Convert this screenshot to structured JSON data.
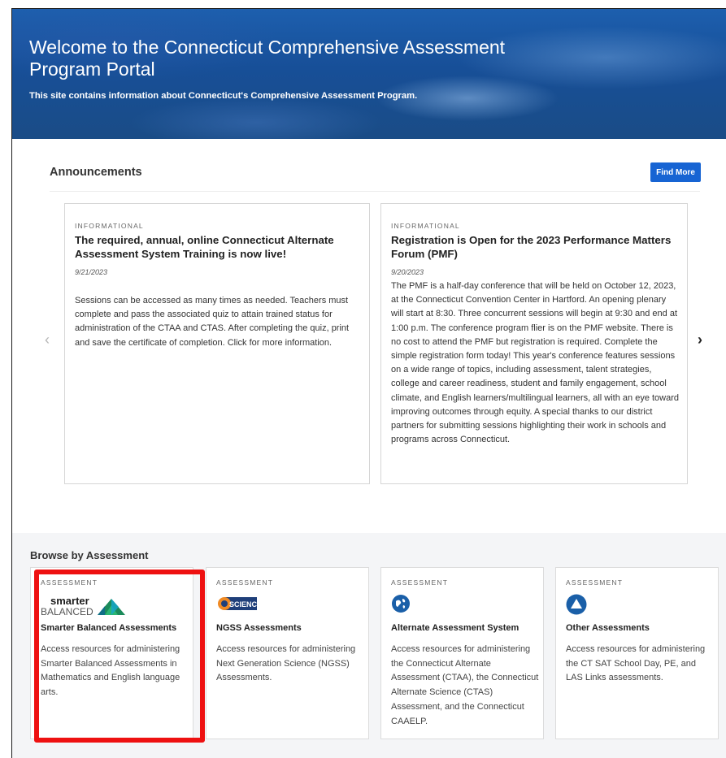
{
  "hero": {
    "title": "Welcome to the Connecticut Comprehensive Assessment Program Portal",
    "subtitle": "This site contains information about Connecticut's Comprehensive Assessment Program."
  },
  "announcements": {
    "heading": "Announcements",
    "find_more_label": "Find More",
    "prev_arrow": "‹",
    "next_arrow": "›",
    "items": [
      {
        "tag": "INFORMATIONAL",
        "title": "The required, annual, online Connecticut Alternate Assessment System Training is now live!",
        "date": "9/21/2023",
        "body": "Sessions can be accessed as many times as needed. Teachers must complete and pass the associated quiz to attain trained status for administration of the CTAA and CTAS. After completing the quiz, print and save the certificate of completion. Click for more information."
      },
      {
        "tag": "INFORMATIONAL",
        "title": "Registration is Open for the 2023 Performance Matters Forum (PMF)",
        "date": "9/20/2023",
        "body": "The PMF is a half-day conference that will be held on October 12, 2023, at the Connecticut Convention Center in Hartford. An opening plenary will start at 8:30. Three concurrent sessions will begin at 9:30 and end at 1:00 p.m. The conference program flier is on the PMF website. There is no cost to attend the PMF but registration is required. Complete the simple registration form today! This year's conference features sessions on a wide range of topics, including assessment, talent strategies, college and career readiness, student and family engagement, school climate, and English learners/multilingual learners, all with an eye toward improving outcomes through equity. A special thanks to our district partners for submitting sessions highlighting their work in schools and programs across Connecticut."
      }
    ]
  },
  "browse": {
    "heading": "Browse by Assessment",
    "items": [
      {
        "tag": "ASSESSMENT",
        "logo_text_1": "smarter",
        "logo_text_2": "BALANCED",
        "title": "Smarter Balanced Assessments",
        "desc": "Access resources for administering Smarter Balanced Assessments in Mathematics and English language arts.",
        "icon": "smarter-balanced-logo"
      },
      {
        "tag": "ASSESSMENT",
        "logo_text": "SCIENCE",
        "title": "NGSS Assessments",
        "desc": "Access resources for administering Next Generation Science (NGSS) Assessments.",
        "icon": "ngss-science-logo"
      },
      {
        "tag": "ASSESSMENT",
        "title": "Alternate Assessment System",
        "desc": "Access resources for administering the Connecticut Alternate Assessment (CTAA), the Connecticut Alternate Science (CTAS) Assessment, and the Connecticut CAAELP.",
        "icon": "globe-icon"
      },
      {
        "tag": "ASSESSMENT",
        "title": "Other Assessments",
        "desc": "Access resources for administering the CT SAT School Day, PE, and LAS Links assessments.",
        "icon": "triangle-icon"
      }
    ]
  },
  "colors": {
    "accent_button": "#1764d3",
    "highlight_border": "#ee1111",
    "hero_blue": "#1d5fae"
  }
}
